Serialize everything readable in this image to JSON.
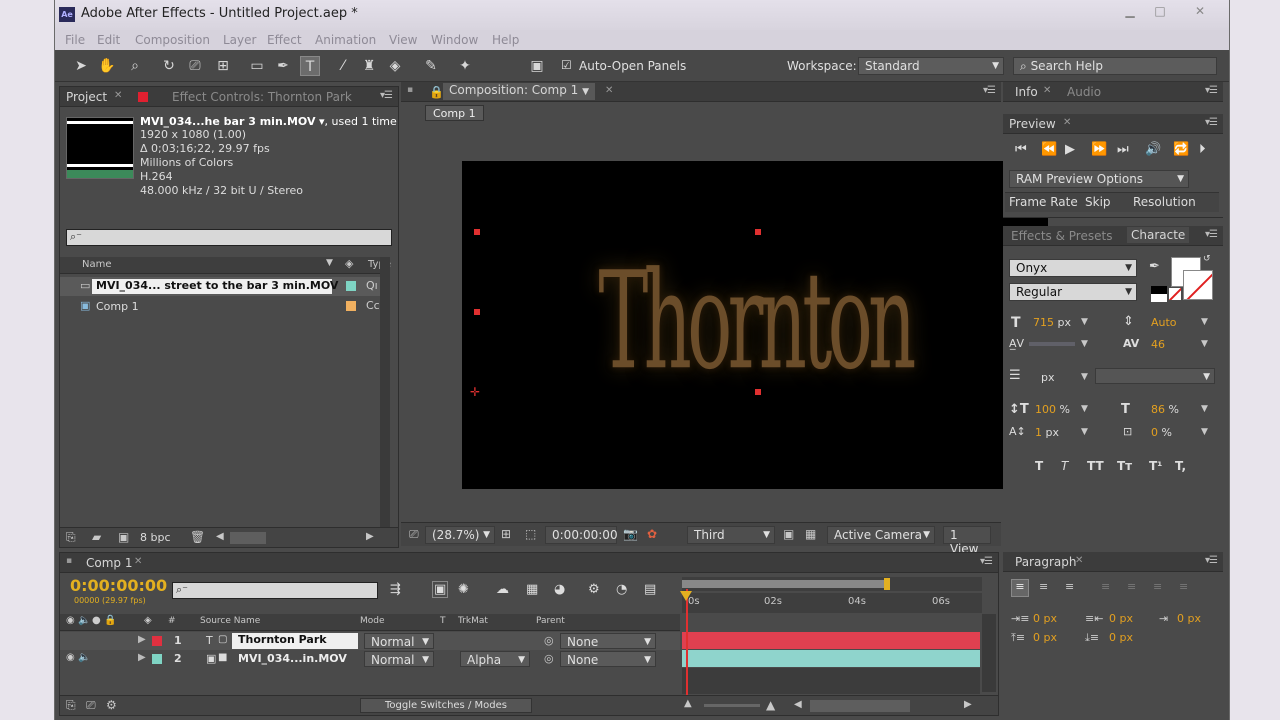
{
  "window": {
    "title": "Adobe After Effects - Untitled Project.aep *",
    "app_icon": "Ae"
  },
  "menu": [
    "File",
    "Edit",
    "Composition",
    "Layer",
    "Effect",
    "Animation",
    "View",
    "Window",
    "Help"
  ],
  "toolbar": {
    "auto_open_label": "Auto-Open Panels",
    "auto_open_checked": true,
    "workspace_label": "Workspace:",
    "workspace_value": "Standard",
    "search_placeholder": "Search Help"
  },
  "project": {
    "tab_project": "Project",
    "tab_effects": "Effect Controls: Thornton Park",
    "file_name": "MVI_034...he bar 3 min.MOV",
    "file_used": ", used 1 time",
    "meta": [
      "1920 x 1080 (1.00)",
      "Δ 0;03;16;22, 29.97 fps",
      "Millions of Colors",
      "H.264",
      "48.000 kHz / 32 bit U / Stereo"
    ],
    "col_name": "Name",
    "col_type": "Type",
    "items": [
      {
        "name": "MVI_034... street to the bar 3 min.MOV",
        "type": "Qı",
        "color": "#7fd4c4"
      },
      {
        "name": "Comp 1",
        "type": "Cc",
        "color": "#f0b060"
      }
    ],
    "bpc": "8 bpc"
  },
  "composition": {
    "tab": "Composition: Comp 1",
    "subtab": "Comp 1",
    "canvas_text": "Thornton Park",
    "zoom": "(28.7%)",
    "timecode": "0:00:00:00",
    "resolution": "Third",
    "camera": "Active Camera",
    "views": "1 View"
  },
  "info": {
    "tab_info": "Info",
    "tab_audio": "Audio"
  },
  "preview": {
    "tab": "Preview",
    "ram_options": "RAM Preview Options",
    "frame_rate": "Frame Rate",
    "skip": "Skip",
    "resolution": "Resolution"
  },
  "character": {
    "tab_effects": "Effects & Presets",
    "tab_char": "Characte",
    "font": "Onyx",
    "style": "Regular",
    "size": "715",
    "size_unit": "px",
    "leading": "Auto",
    "tracking": "46",
    "indent_unit": "px",
    "vscale": "100",
    "hscale": "86",
    "baseline": "1",
    "baseline_unit": "px",
    "tsume": "0",
    "pct": "%",
    "styles": [
      "T",
      "T",
      "TT",
      "Tт",
      "T¹",
      "T,"
    ]
  },
  "paragraph": {
    "tab": "Paragraph",
    "values": [
      "0 px",
      "0 px",
      "0 px",
      "0 px",
      "0 px"
    ]
  },
  "timeline": {
    "tab": "Comp 1",
    "timecode": "0:00:00:00",
    "frames": "00000 (29.97 fps)",
    "col_num": "#",
    "col_source": "Source Name",
    "col_mode": "Mode",
    "col_t": "T",
    "col_trkmat": "TrkMat",
    "col_parent": "Parent",
    "layers": [
      {
        "num": "1",
        "type": "T",
        "name": "Thornton Park",
        "mode": "Normal",
        "trkmat": "",
        "parent": "None",
        "color": "#e03040",
        "bar": "#e04050"
      },
      {
        "num": "2",
        "type": "▣",
        "name": "MVI_034...in.MOV",
        "mode": "Normal",
        "trkmat": "Alpha",
        "parent": "None",
        "color": "#7fd4c4",
        "bar": "#8fd4cc"
      }
    ],
    "ruler": [
      "0s",
      "02s",
      "04s",
      "06s"
    ],
    "toggle": "Toggle Switches / Modes"
  }
}
